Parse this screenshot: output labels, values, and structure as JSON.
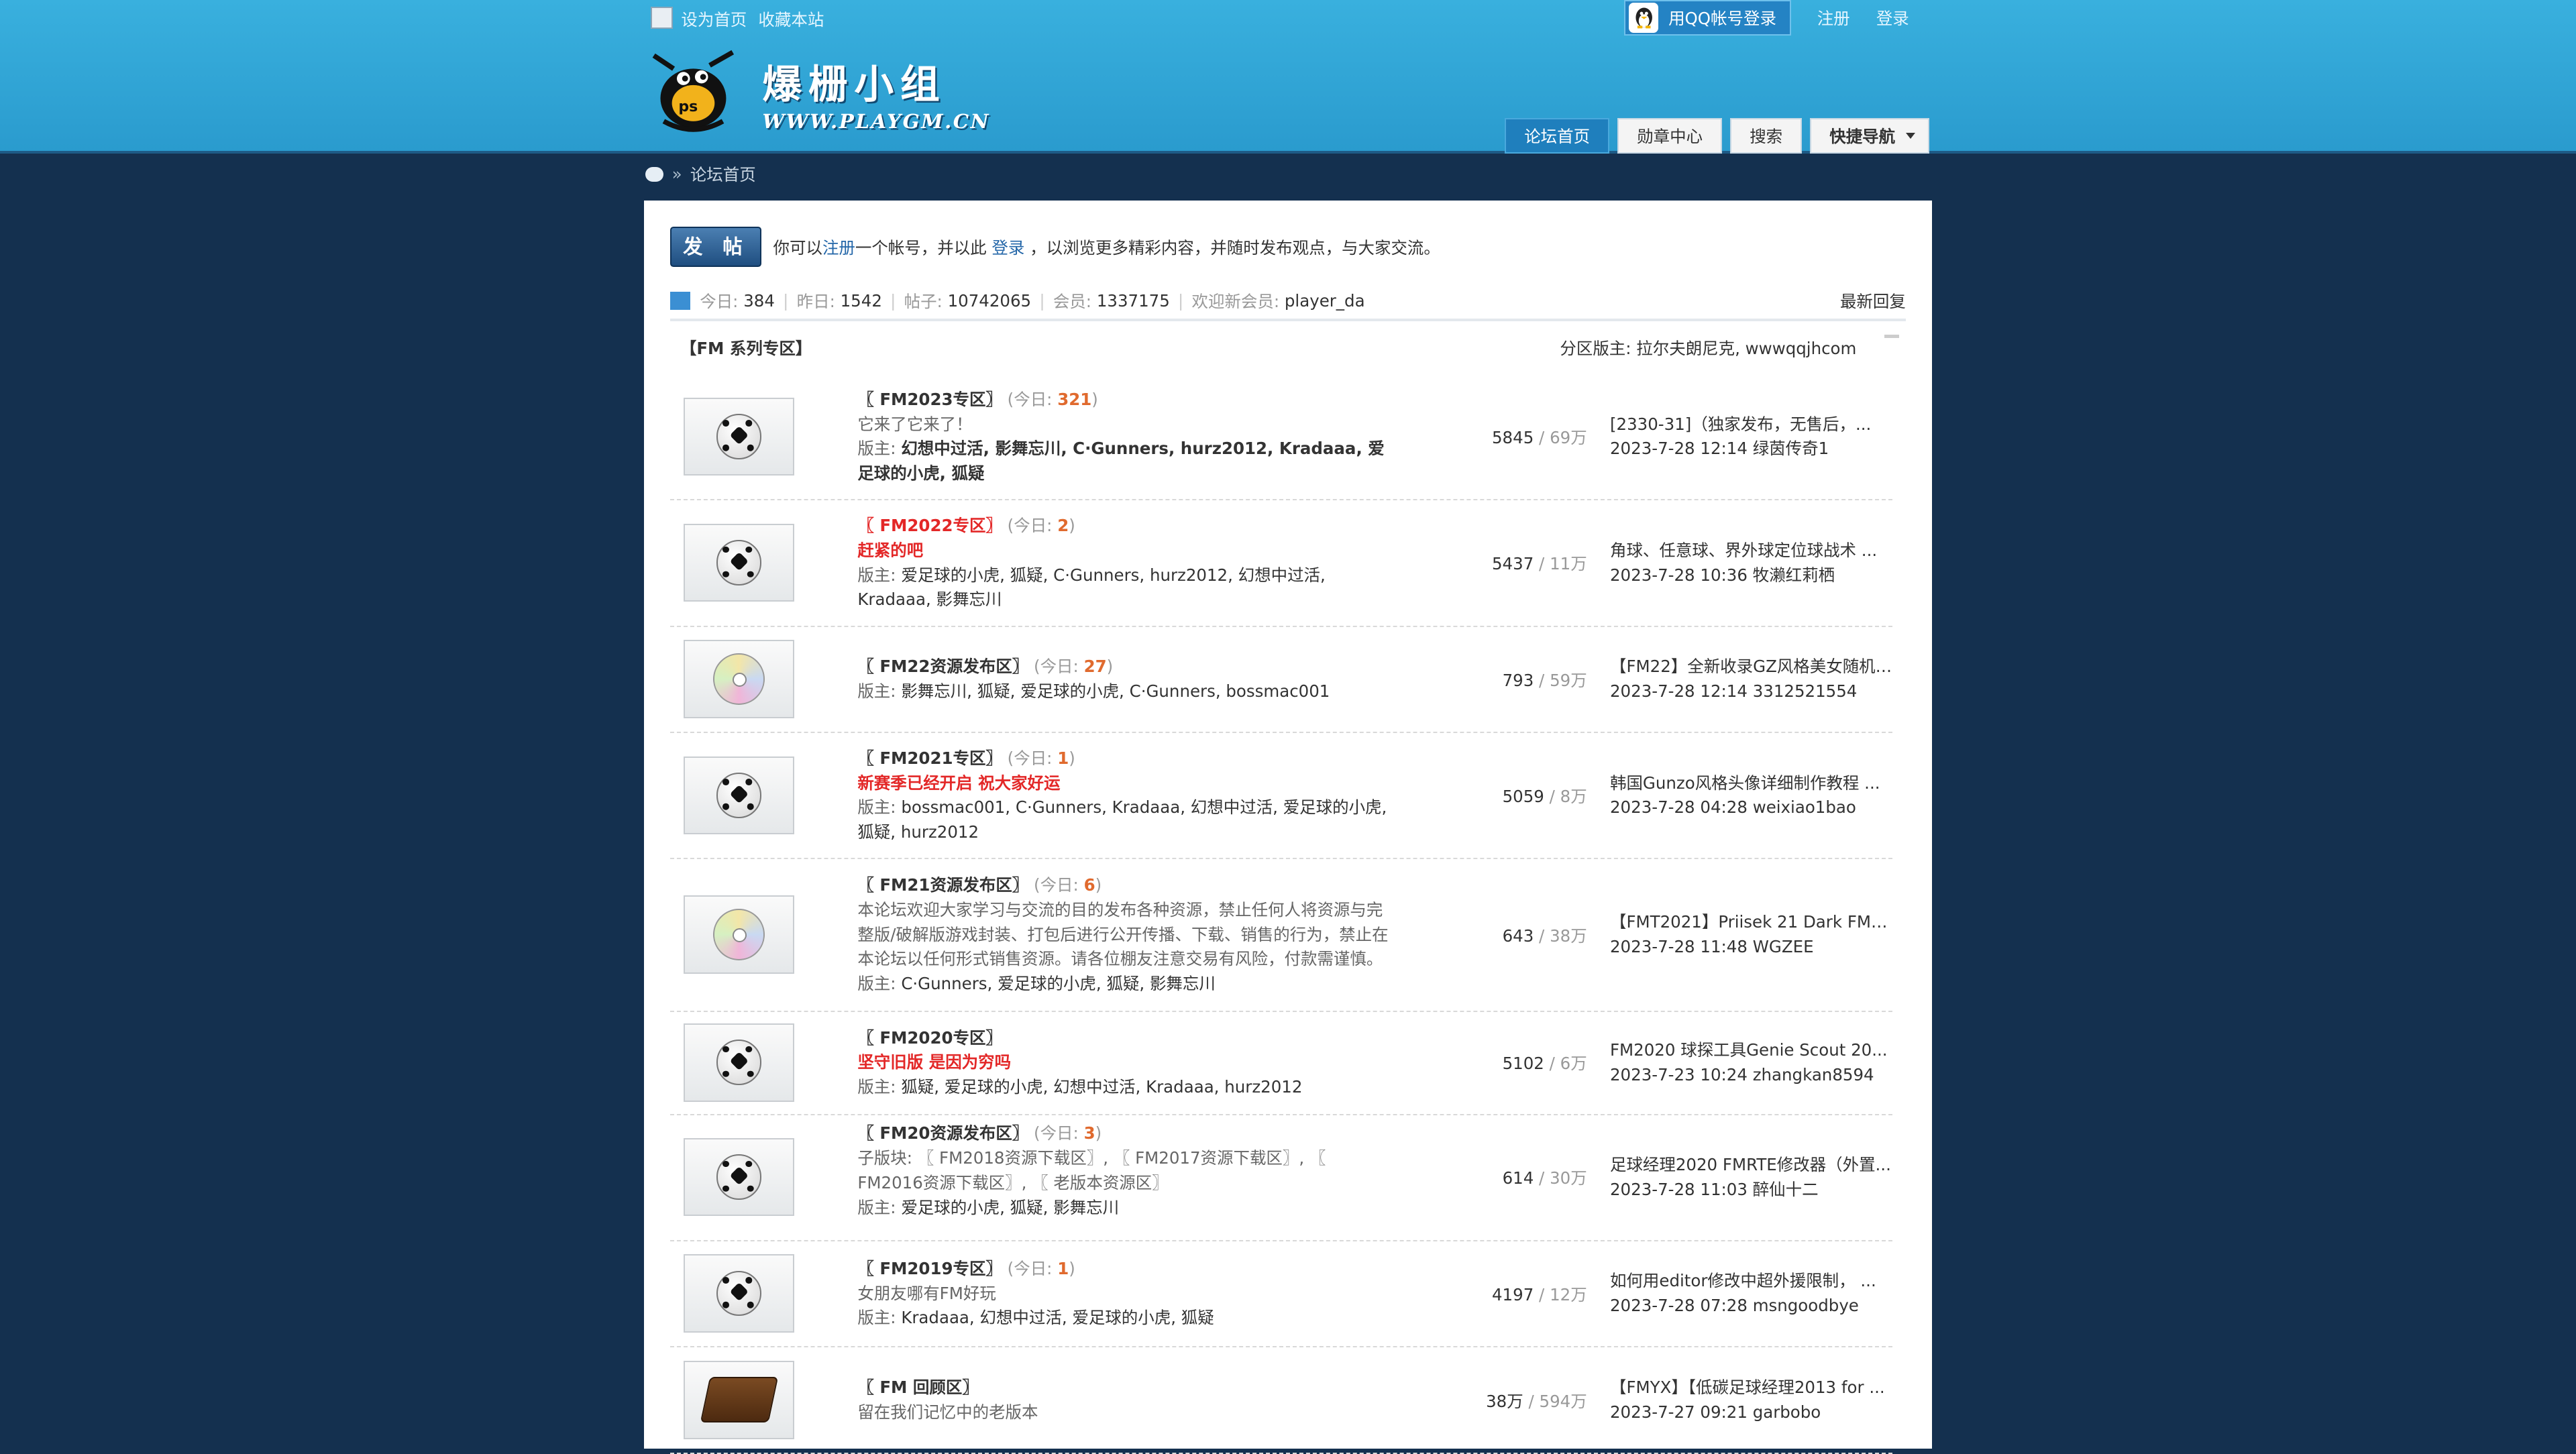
{
  "top_links": {
    "set_home": "设为首页",
    "bookmark": "收藏本站",
    "qq_login": "用QQ帐号登录",
    "register": "注册",
    "login": "登录"
  },
  "logo": {
    "cn": "爆栅小组",
    "url": "WWW.PLAYGM.CN"
  },
  "nav": {
    "tabs": [
      "论坛首页",
      "勋章中心",
      "搜索"
    ],
    "quick_nav": "快捷导航"
  },
  "breadcrumb": {
    "sep": "»",
    "current": "论坛首页"
  },
  "post": {
    "button": "发 帖",
    "note_prefix": "你可以",
    "register_link": "注册",
    "note_mid": "一个帐号，并以此",
    "login_link": "登录",
    "note_suffix": "，以浏览更多精彩内容，并随时发布观点，与大家交流。"
  },
  "stats": {
    "today_label": "今日:",
    "today": "384",
    "yesterday_label": "昨日:",
    "yesterday": "1542",
    "posts_label": "帖子:",
    "posts": "10742065",
    "members_label": "会员:",
    "members": "1337175",
    "newest_label": "欢迎新会员:",
    "newest": "player_da",
    "latest_reply": "最新回复"
  },
  "category": {
    "name": "【FM 系列专区】",
    "mods_label": "分区版主:",
    "mods": "拉尔夫朗尼克, wwwqqjhcom"
  },
  "today_label": "今日:",
  "mods_label": "版主:",
  "forums": [
    {
      "icon": "ball",
      "title": "〖 FM2023专区〗",
      "title_red": false,
      "today": "321",
      "desc": "它来了它来了！",
      "desc_red": false,
      "mods": "幻想中过活, 影舞忘川, C·Gunners, hurz2012, Kradaaa, 爱足球的小虎, 狐疑",
      "mods_bold": true,
      "threads": "5845",
      "posts": "69万",
      "last_subject": "[2330-31]（独家发布，无售后，...",
      "last_meta": "2023-7-28 12:14 绿茵传奇1"
    },
    {
      "icon": "ball",
      "title": "〖 FM2022专区〗",
      "title_red": true,
      "today": "2",
      "desc": "赶紧的吧",
      "desc_red": true,
      "mods": "爱足球的小虎, 狐疑, C·Gunners, hurz2012, 幻想中过活, Kradaaa, 影舞忘川",
      "mods_bold": false,
      "threads": "5437",
      "posts": "11万",
      "last_subject": "角球、任意球、界外球定位球战术 ...",
      "last_meta": "2023-7-28 10:36 牧濑红莉栖"
    },
    {
      "icon": "disc",
      "title": "〖 FM22资源发布区〗",
      "title_red": false,
      "today": "27",
      "desc": "",
      "desc_red": false,
      "mods": "影舞忘川, 狐疑, 爱足球的小虎, C·Gunners, bossmac001",
      "mods_bold": false,
      "threads": "793",
      "posts": "59万",
      "last_subject": "【FM22】全新收录GZ风格美女随机 ...",
      "last_meta": "2023-7-28 12:14 3312521554"
    },
    {
      "icon": "ball",
      "title": "〖 FM2021专区〗",
      "title_red": false,
      "today": "1",
      "desc": "新赛季已经开启 祝大家好运",
      "desc_red": true,
      "mods": "bossmac001, C·Gunners, Kradaaa, 幻想中过活, 爱足球的小虎, 狐疑, hurz2012",
      "mods_bold": false,
      "threads": "5059",
      "posts": "8万",
      "last_subject": "韩国Gunzo风格头像详细制作教程 ...",
      "last_meta": "2023-7-28 04:28 weixiao1bao"
    },
    {
      "icon": "disc",
      "title": "〖 FM21资源发布区〗",
      "title_red": false,
      "today": "6",
      "desc": "本论坛欢迎大家学习与交流的目的发布各种资源，禁止任何人将资源与完整版/破解版游戏封装、打包后进行公开传播、下载、销售的行为，禁止在本论坛以任何形式销售资源。请各位棚友注意交易有风险，付款需谨慎。",
      "desc_red": false,
      "mods": "C·Gunners, 爱足球的小虎, 狐疑, 影舞忘川",
      "mods_bold": false,
      "threads": "643",
      "posts": "38万",
      "last_subject": "【FMT2021】Priisek 21 Dark FMT...",
      "last_meta": "2023-7-28 11:48 WGZEE"
    },
    {
      "icon": "ball",
      "title": "〖 FM2020专区〗",
      "title_red": false,
      "today": "",
      "desc": "坚守旧版 是因为穷吗",
      "desc_red": true,
      "mods": "狐疑, 爱足球的小虎, 幻想中过活, Kradaaa, hurz2012",
      "mods_bold": false,
      "threads": "5102",
      "posts": "6万",
      "last_subject": "FM2020 球探工具Genie Scout 20...",
      "last_meta": "2023-7-23 10:24 zhangkan8594"
    },
    {
      "icon": "ball",
      "title": "〖 FM20资源发布区〗",
      "title_red": false,
      "today": "3",
      "desc": "子版块: 〖 FM2018资源下载区〗, 〖 FM2017资源下载区〗, 〖 FM2016资源下载区〗, 〖 老版本资源区〗",
      "desc_red": false,
      "mods": "爱足球的小虎, 狐疑, 影舞忘川",
      "mods_bold": false,
      "threads": "614",
      "posts": "30万",
      "last_subject": "足球经理2020 FMRTE修改器（外置...",
      "last_meta": "2023-7-28 11:03 醉仙十二"
    },
    {
      "icon": "ball",
      "title": "〖 FM2019专区〗",
      "title_red": false,
      "today": "1",
      "desc": "女朋友哪有FM好玩",
      "desc_red": false,
      "mods": "Kradaaa, 幻想中过活, 爱足球的小虎, 狐疑",
      "mods_bold": false,
      "threads": "4197",
      "posts": "12万",
      "last_subject": "如何用editor修改中超外援限制， ...",
      "last_meta": "2023-7-28 07:28 msngoodbye"
    },
    {
      "icon": "book",
      "title": "〖 FM 回顾区〗",
      "title_red": false,
      "today": "",
      "desc": "留在我们记忆中的老版本",
      "desc_red": false,
      "mods": "",
      "mods_bold": false,
      "threads": "38万",
      "posts": "594万",
      "last_subject": "【FMYX】【低碳足球经理2013 for ...",
      "last_meta": "2023-7-27 09:21 garbobo"
    }
  ]
}
